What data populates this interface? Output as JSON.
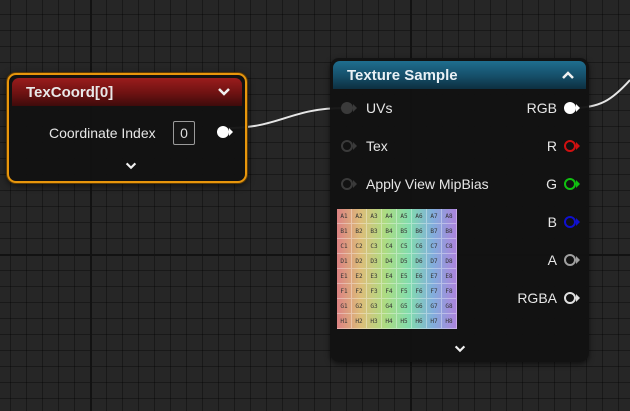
{
  "colors": {
    "canvas_bg": "#262626",
    "texcoord_header": "#8b1a1a",
    "texcoord_selection": "#e8960c",
    "texture_header": "#1a5e7c",
    "pin_r": "#d01010",
    "pin_g": "#10c010",
    "pin_b": "#1010d0",
    "pin_white": "#ffffff",
    "pin_gray": "#a0a0a0"
  },
  "texcoord_node": {
    "title": "TexCoord[0]",
    "input_label": "Coordinate Index",
    "input_value": "0",
    "collapse_icon": "chevron-down-icon",
    "expand_icon": "chevron-down-icon"
  },
  "texture_sample_node": {
    "title": "Texture Sample",
    "collapse_icon": "chevron-up-icon",
    "expand_icon": "chevron-down-icon",
    "inputs": [
      {
        "label": "UVs"
      },
      {
        "label": "Tex"
      },
      {
        "label": "Apply View MipBias"
      }
    ],
    "outputs": [
      {
        "label": "RGB"
      },
      {
        "label": "R"
      },
      {
        "label": "G"
      },
      {
        "label": "B"
      },
      {
        "label": "A"
      },
      {
        "label": "RGBA"
      }
    ],
    "preview": {
      "icon": "texture-preview-thumbnail",
      "cells": [
        "A1",
        "A2",
        "A3",
        "A4",
        "A5",
        "A6",
        "A7",
        "A8",
        "B1",
        "B2",
        "B3",
        "B4",
        "B5",
        "B6",
        "B7",
        "B8",
        "C1",
        "C2",
        "C3",
        "C4",
        "C5",
        "C6",
        "C7",
        "C8",
        "D1",
        "D2",
        "D3",
        "D4",
        "D5",
        "D6",
        "D7",
        "D8",
        "E1",
        "E2",
        "E3",
        "E4",
        "E5",
        "E6",
        "E7",
        "E8",
        "F1",
        "F2",
        "F3",
        "F4",
        "F5",
        "F6",
        "F7",
        "F8",
        "G1",
        "G2",
        "G3",
        "G4",
        "G5",
        "G6",
        "G7",
        "G8",
        "H1",
        "H2",
        "H3",
        "H4",
        "H5",
        "H6",
        "H7",
        "H8"
      ]
    }
  }
}
